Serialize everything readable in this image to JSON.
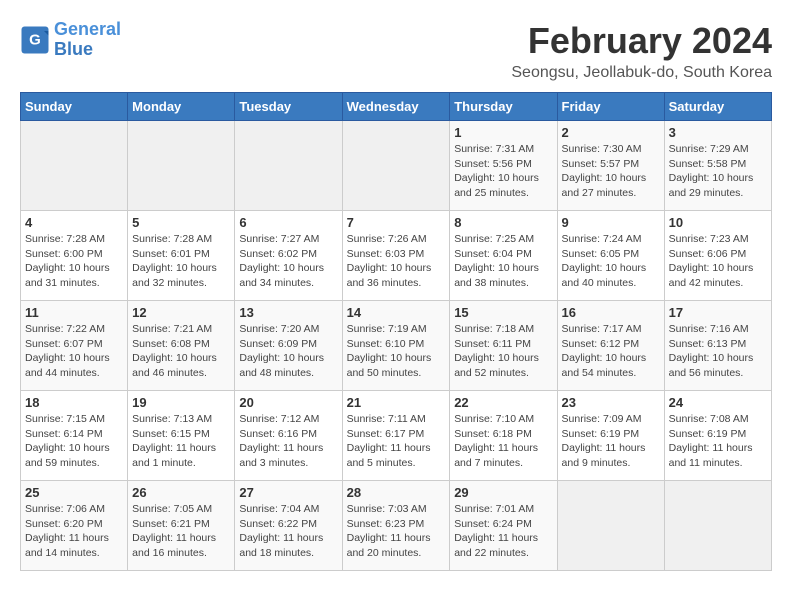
{
  "header": {
    "logo_line1": "General",
    "logo_line2": "Blue",
    "title": "February 2024",
    "subtitle": "Seongsu, Jeollabuk-do, South Korea"
  },
  "days_of_week": [
    "Sunday",
    "Monday",
    "Tuesday",
    "Wednesday",
    "Thursday",
    "Friday",
    "Saturday"
  ],
  "weeks": [
    [
      {
        "day": "",
        "info": ""
      },
      {
        "day": "",
        "info": ""
      },
      {
        "day": "",
        "info": ""
      },
      {
        "day": "",
        "info": ""
      },
      {
        "day": "1",
        "info": "Sunrise: 7:31 AM\nSunset: 5:56 PM\nDaylight: 10 hours\nand 25 minutes."
      },
      {
        "day": "2",
        "info": "Sunrise: 7:30 AM\nSunset: 5:57 PM\nDaylight: 10 hours\nand 27 minutes."
      },
      {
        "day": "3",
        "info": "Sunrise: 7:29 AM\nSunset: 5:58 PM\nDaylight: 10 hours\nand 29 minutes."
      }
    ],
    [
      {
        "day": "4",
        "info": "Sunrise: 7:28 AM\nSunset: 6:00 PM\nDaylight: 10 hours\nand 31 minutes."
      },
      {
        "day": "5",
        "info": "Sunrise: 7:28 AM\nSunset: 6:01 PM\nDaylight: 10 hours\nand 32 minutes."
      },
      {
        "day": "6",
        "info": "Sunrise: 7:27 AM\nSunset: 6:02 PM\nDaylight: 10 hours\nand 34 minutes."
      },
      {
        "day": "7",
        "info": "Sunrise: 7:26 AM\nSunset: 6:03 PM\nDaylight: 10 hours\nand 36 minutes."
      },
      {
        "day": "8",
        "info": "Sunrise: 7:25 AM\nSunset: 6:04 PM\nDaylight: 10 hours\nand 38 minutes."
      },
      {
        "day": "9",
        "info": "Sunrise: 7:24 AM\nSunset: 6:05 PM\nDaylight: 10 hours\nand 40 minutes."
      },
      {
        "day": "10",
        "info": "Sunrise: 7:23 AM\nSunset: 6:06 PM\nDaylight: 10 hours\nand 42 minutes."
      }
    ],
    [
      {
        "day": "11",
        "info": "Sunrise: 7:22 AM\nSunset: 6:07 PM\nDaylight: 10 hours\nand 44 minutes."
      },
      {
        "day": "12",
        "info": "Sunrise: 7:21 AM\nSunset: 6:08 PM\nDaylight: 10 hours\nand 46 minutes."
      },
      {
        "day": "13",
        "info": "Sunrise: 7:20 AM\nSunset: 6:09 PM\nDaylight: 10 hours\nand 48 minutes."
      },
      {
        "day": "14",
        "info": "Sunrise: 7:19 AM\nSunset: 6:10 PM\nDaylight: 10 hours\nand 50 minutes."
      },
      {
        "day": "15",
        "info": "Sunrise: 7:18 AM\nSunset: 6:11 PM\nDaylight: 10 hours\nand 52 minutes."
      },
      {
        "day": "16",
        "info": "Sunrise: 7:17 AM\nSunset: 6:12 PM\nDaylight: 10 hours\nand 54 minutes."
      },
      {
        "day": "17",
        "info": "Sunrise: 7:16 AM\nSunset: 6:13 PM\nDaylight: 10 hours\nand 56 minutes."
      }
    ],
    [
      {
        "day": "18",
        "info": "Sunrise: 7:15 AM\nSunset: 6:14 PM\nDaylight: 10 hours\nand 59 minutes."
      },
      {
        "day": "19",
        "info": "Sunrise: 7:13 AM\nSunset: 6:15 PM\nDaylight: 11 hours\nand 1 minute."
      },
      {
        "day": "20",
        "info": "Sunrise: 7:12 AM\nSunset: 6:16 PM\nDaylight: 11 hours\nand 3 minutes."
      },
      {
        "day": "21",
        "info": "Sunrise: 7:11 AM\nSunset: 6:17 PM\nDaylight: 11 hours\nand 5 minutes."
      },
      {
        "day": "22",
        "info": "Sunrise: 7:10 AM\nSunset: 6:18 PM\nDaylight: 11 hours\nand 7 minutes."
      },
      {
        "day": "23",
        "info": "Sunrise: 7:09 AM\nSunset: 6:19 PM\nDaylight: 11 hours\nand 9 minutes."
      },
      {
        "day": "24",
        "info": "Sunrise: 7:08 AM\nSunset: 6:19 PM\nDaylight: 11 hours\nand 11 minutes."
      }
    ],
    [
      {
        "day": "25",
        "info": "Sunrise: 7:06 AM\nSunset: 6:20 PM\nDaylight: 11 hours\nand 14 minutes."
      },
      {
        "day": "26",
        "info": "Sunrise: 7:05 AM\nSunset: 6:21 PM\nDaylight: 11 hours\nand 16 minutes."
      },
      {
        "day": "27",
        "info": "Sunrise: 7:04 AM\nSunset: 6:22 PM\nDaylight: 11 hours\nand 18 minutes."
      },
      {
        "day": "28",
        "info": "Sunrise: 7:03 AM\nSunset: 6:23 PM\nDaylight: 11 hours\nand 20 minutes."
      },
      {
        "day": "29",
        "info": "Sunrise: 7:01 AM\nSunset: 6:24 PM\nDaylight: 11 hours\nand 22 minutes."
      },
      {
        "day": "",
        "info": ""
      },
      {
        "day": "",
        "info": ""
      }
    ]
  ]
}
